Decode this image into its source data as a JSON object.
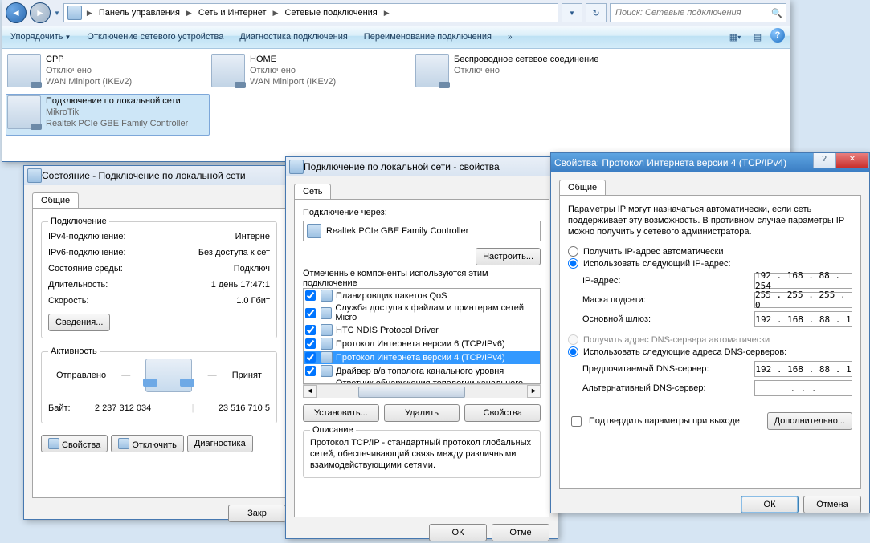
{
  "explorer": {
    "win_controls": {
      "min": "—",
      "max": "❐",
      "close": "✕"
    },
    "breadcrumbs": [
      "Панель управления",
      "Сеть и Интернет",
      "Сетевые подключения"
    ],
    "search_placeholder": "Поиск: Сетевые подключения",
    "toolbar": {
      "organize": "Упорядочить",
      "disable": "Отключение сетевого устройства",
      "diagnose": "Диагностика подключения",
      "rename": "Переименование подключения"
    },
    "connections": [
      {
        "name": "CPP",
        "status": "Отключено",
        "device": "WAN Miniport (IKEv2)"
      },
      {
        "name": "HOME",
        "status": "Отключено",
        "device": "WAN Miniport (IKEv2)"
      },
      {
        "name": "Беспроводное сетевое соединение",
        "status": "Отключено",
        "device": ""
      },
      {
        "name": "Подключение по локальной сети",
        "status": "MikroTik",
        "device": "Realtek PCIe GBE Family Controller",
        "selected": true
      }
    ]
  },
  "status_dlg": {
    "title": "Состояние - Подключение по локальной сети",
    "tab": "Общие",
    "group_conn": "Подключение",
    "rows": {
      "ipv4_l": "IPv4-подключение:",
      "ipv4_v": "Интерне",
      "ipv6_l": "IPv6-подключение:",
      "ipv6_v": "Без доступа к сет",
      "media_l": "Состояние среды:",
      "media_v": "Подключ",
      "dur_l": "Длительность:",
      "dur_v": "1 день 17:47:1",
      "speed_l": "Скорость:",
      "speed_v": "1.0 Гбит"
    },
    "details_btn": "Сведения...",
    "group_act": "Активность",
    "act_sent": "Отправлено",
    "act_recv": "Принят",
    "act_bytes_l": "Байт:",
    "act_sent_v": "2 237 312 034",
    "act_recv_v": "23 516 710 5",
    "btn_props": "Свойства",
    "btn_disable": "Отключить",
    "btn_diag": "Диагностика",
    "btn_close": "Закр"
  },
  "props_dlg": {
    "title": "Подключение по локальной сети - свойства",
    "tab": "Сеть",
    "connect_using_l": "Подключение через:",
    "adapter": "Realtek PCIe GBE Family Controller",
    "configure_btn": "Настроить...",
    "components_l": "Отмеченные компоненты используются этим подключение",
    "components": [
      "Планировщик пакетов QoS",
      "Служба доступа к файлам и принтерам сетей Micro",
      "HTC NDIS Protocol Driver",
      "Протокол Интернета версии 6 (TCP/IPv6)",
      "Протокол Интернета версии 4 (TCP/IPv4)",
      "Драйвер в/в тополога канального уровня",
      "Ответчик обнаружения топологии канального уро"
    ],
    "selected_index": 4,
    "btn_install": "Установить...",
    "btn_uninstall": "Удалить",
    "btn_props": "Свойства",
    "desc_title": "Описание",
    "desc_text": "Протокол TCP/IP - стандартный протокол глобальных сетей, обеспечивающий связь между различными взаимодействующими сетями.",
    "btn_ok": "ОК",
    "btn_cancel": "Отме"
  },
  "ip_dlg": {
    "title": "Свойства: Протокол Интернета версии 4 (TCP/IPv4)",
    "tab": "Общие",
    "intro": "Параметры IP могут назначаться автоматически, если сеть поддерживает эту возможность. В противном случае параметры IP можно получить у сетевого администратора.",
    "r_auto_ip": "Получить IP-адрес автоматически",
    "r_manual_ip": "Использовать следующий IP-адрес:",
    "ip_l": "IP-адрес:",
    "ip_v": "192 . 168 .  88  . 254",
    "mask_l": "Маска подсети:",
    "mask_v": "255 . 255 . 255 .   0",
    "gw_l": "Основной шлюз:",
    "gw_v": "192 . 168 .  88  .   1",
    "r_auto_dns": "Получить адрес DNS-сервера автоматически",
    "r_manual_dns": "Использовать следующие адреса DNS-серверов:",
    "dns1_l": "Предпочитаемый DNS-сервер:",
    "dns1_v": "192 . 168 .  88  .   1",
    "dns2_l": "Альтернативный DNS-сервер:",
    "dns2_v": " .       .       .",
    "validate": "Подтвердить параметры при выходе",
    "btn_adv": "Дополнительно...",
    "btn_ok": "ОК",
    "btn_cancel": "Отмена"
  }
}
